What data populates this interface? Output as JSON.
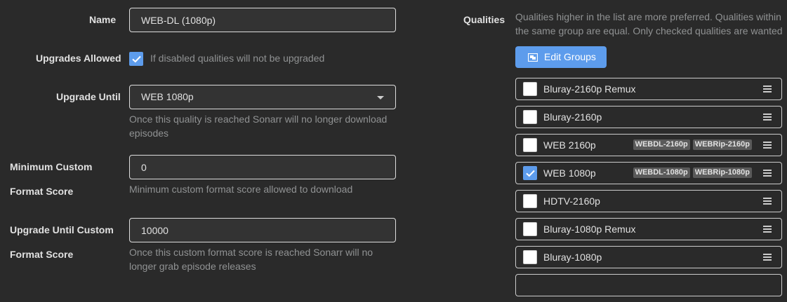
{
  "form": {
    "name": {
      "label": "Name",
      "value": "WEB-DL (1080p)"
    },
    "upgrades_allowed": {
      "label": "Upgrades Allowed",
      "checked": true,
      "help": "If disabled qualities will not be upgraded"
    },
    "upgrade_until": {
      "label": "Upgrade Until",
      "value": "WEB 1080p",
      "help_line1": "Once this quality is reached Sonarr will no longer download",
      "help_line2": "episodes"
    },
    "min_custom_format_score": {
      "label_line1": "Minimum Custom",
      "label_line2": "Format Score",
      "value": "0",
      "help": "Minimum custom format score allowed to download"
    },
    "upgrade_until_custom_format_score": {
      "label_line1": "Upgrade Until Custom",
      "label_line2": "Format Score",
      "value": "10000",
      "help_line1": "Once this custom format score is reached Sonarr will no",
      "help_line2": "longer grab episode releases"
    }
  },
  "qualities": {
    "label": "Qualities",
    "help_line1": "Qualities higher in the list are more preferred. Qualities within",
    "help_line2": "the same group are equal. Only checked qualities are wanted",
    "edit_groups_label": "Edit Groups",
    "items": [
      {
        "name": "Bluray-2160p Remux",
        "checked": false,
        "tags": []
      },
      {
        "name": "Bluray-2160p",
        "checked": false,
        "tags": []
      },
      {
        "name": "WEB 2160p",
        "checked": false,
        "tags": [
          "WEBDL-2160p",
          "WEBRip-2160p"
        ]
      },
      {
        "name": "WEB 1080p",
        "checked": true,
        "tags": [
          "WEBDL-1080p",
          "WEBRip-1080p"
        ]
      },
      {
        "name": "HDTV-2160p",
        "checked": false,
        "tags": []
      },
      {
        "name": "Bluray-1080p Remux",
        "checked": false,
        "tags": []
      },
      {
        "name": "Bluray-1080p",
        "checked": false,
        "tags": []
      }
    ]
  },
  "colors": {
    "accent": "#5d9cec",
    "background": "#2a2a2a",
    "tag": "#5a5a5a"
  }
}
